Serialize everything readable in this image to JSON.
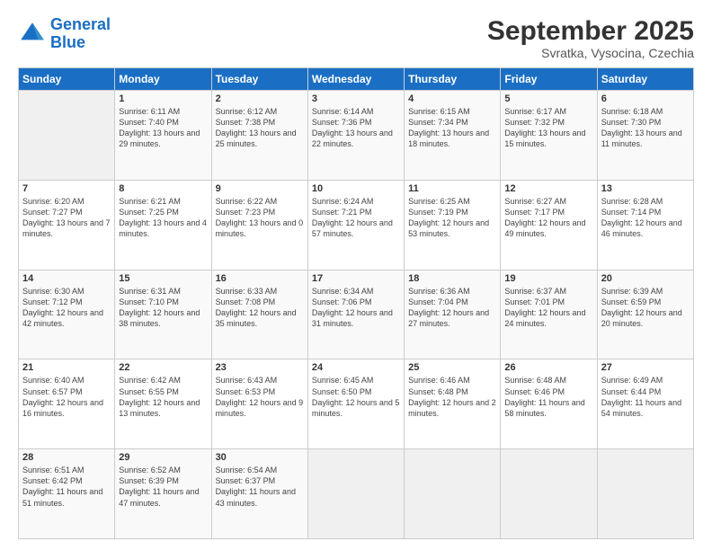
{
  "header": {
    "logo_general": "General",
    "logo_blue": "Blue",
    "month": "September 2025",
    "location": "Svratka, Vysocina, Czechia"
  },
  "weekdays": [
    "Sunday",
    "Monday",
    "Tuesday",
    "Wednesday",
    "Thursday",
    "Friday",
    "Saturday"
  ],
  "weeks": [
    [
      {
        "day": "",
        "sunrise": "",
        "sunset": "",
        "daylight": ""
      },
      {
        "day": "1",
        "sunrise": "Sunrise: 6:11 AM",
        "sunset": "Sunset: 7:40 PM",
        "daylight": "Daylight: 13 hours and 29 minutes."
      },
      {
        "day": "2",
        "sunrise": "Sunrise: 6:12 AM",
        "sunset": "Sunset: 7:38 PM",
        "daylight": "Daylight: 13 hours and 25 minutes."
      },
      {
        "day": "3",
        "sunrise": "Sunrise: 6:14 AM",
        "sunset": "Sunset: 7:36 PM",
        "daylight": "Daylight: 13 hours and 22 minutes."
      },
      {
        "day": "4",
        "sunrise": "Sunrise: 6:15 AM",
        "sunset": "Sunset: 7:34 PM",
        "daylight": "Daylight: 13 hours and 18 minutes."
      },
      {
        "day": "5",
        "sunrise": "Sunrise: 6:17 AM",
        "sunset": "Sunset: 7:32 PM",
        "daylight": "Daylight: 13 hours and 15 minutes."
      },
      {
        "day": "6",
        "sunrise": "Sunrise: 6:18 AM",
        "sunset": "Sunset: 7:30 PM",
        "daylight": "Daylight: 13 hours and 11 minutes."
      }
    ],
    [
      {
        "day": "7",
        "sunrise": "Sunrise: 6:20 AM",
        "sunset": "Sunset: 7:27 PM",
        "daylight": "Daylight: 13 hours and 7 minutes."
      },
      {
        "day": "8",
        "sunrise": "Sunrise: 6:21 AM",
        "sunset": "Sunset: 7:25 PM",
        "daylight": "Daylight: 13 hours and 4 minutes."
      },
      {
        "day": "9",
        "sunrise": "Sunrise: 6:22 AM",
        "sunset": "Sunset: 7:23 PM",
        "daylight": "Daylight: 13 hours and 0 minutes."
      },
      {
        "day": "10",
        "sunrise": "Sunrise: 6:24 AM",
        "sunset": "Sunset: 7:21 PM",
        "daylight": "Daylight: 12 hours and 57 minutes."
      },
      {
        "day": "11",
        "sunrise": "Sunrise: 6:25 AM",
        "sunset": "Sunset: 7:19 PM",
        "daylight": "Daylight: 12 hours and 53 minutes."
      },
      {
        "day": "12",
        "sunrise": "Sunrise: 6:27 AM",
        "sunset": "Sunset: 7:17 PM",
        "daylight": "Daylight: 12 hours and 49 minutes."
      },
      {
        "day": "13",
        "sunrise": "Sunrise: 6:28 AM",
        "sunset": "Sunset: 7:14 PM",
        "daylight": "Daylight: 12 hours and 46 minutes."
      }
    ],
    [
      {
        "day": "14",
        "sunrise": "Sunrise: 6:30 AM",
        "sunset": "Sunset: 7:12 PM",
        "daylight": "Daylight: 12 hours and 42 minutes."
      },
      {
        "day": "15",
        "sunrise": "Sunrise: 6:31 AM",
        "sunset": "Sunset: 7:10 PM",
        "daylight": "Daylight: 12 hours and 38 minutes."
      },
      {
        "day": "16",
        "sunrise": "Sunrise: 6:33 AM",
        "sunset": "Sunset: 7:08 PM",
        "daylight": "Daylight: 12 hours and 35 minutes."
      },
      {
        "day": "17",
        "sunrise": "Sunrise: 6:34 AM",
        "sunset": "Sunset: 7:06 PM",
        "daylight": "Daylight: 12 hours and 31 minutes."
      },
      {
        "day": "18",
        "sunrise": "Sunrise: 6:36 AM",
        "sunset": "Sunset: 7:04 PM",
        "daylight": "Daylight: 12 hours and 27 minutes."
      },
      {
        "day": "19",
        "sunrise": "Sunrise: 6:37 AM",
        "sunset": "Sunset: 7:01 PM",
        "daylight": "Daylight: 12 hours and 24 minutes."
      },
      {
        "day": "20",
        "sunrise": "Sunrise: 6:39 AM",
        "sunset": "Sunset: 6:59 PM",
        "daylight": "Daylight: 12 hours and 20 minutes."
      }
    ],
    [
      {
        "day": "21",
        "sunrise": "Sunrise: 6:40 AM",
        "sunset": "Sunset: 6:57 PM",
        "daylight": "Daylight: 12 hours and 16 minutes."
      },
      {
        "day": "22",
        "sunrise": "Sunrise: 6:42 AM",
        "sunset": "Sunset: 6:55 PM",
        "daylight": "Daylight: 12 hours and 13 minutes."
      },
      {
        "day": "23",
        "sunrise": "Sunrise: 6:43 AM",
        "sunset": "Sunset: 6:53 PM",
        "daylight": "Daylight: 12 hours and 9 minutes."
      },
      {
        "day": "24",
        "sunrise": "Sunrise: 6:45 AM",
        "sunset": "Sunset: 6:50 PM",
        "daylight": "Daylight: 12 hours and 5 minutes."
      },
      {
        "day": "25",
        "sunrise": "Sunrise: 6:46 AM",
        "sunset": "Sunset: 6:48 PM",
        "daylight": "Daylight: 12 hours and 2 minutes."
      },
      {
        "day": "26",
        "sunrise": "Sunrise: 6:48 AM",
        "sunset": "Sunset: 6:46 PM",
        "daylight": "Daylight: 11 hours and 58 minutes."
      },
      {
        "day": "27",
        "sunrise": "Sunrise: 6:49 AM",
        "sunset": "Sunset: 6:44 PM",
        "daylight": "Daylight: 11 hours and 54 minutes."
      }
    ],
    [
      {
        "day": "28",
        "sunrise": "Sunrise: 6:51 AM",
        "sunset": "Sunset: 6:42 PM",
        "daylight": "Daylight: 11 hours and 51 minutes."
      },
      {
        "day": "29",
        "sunrise": "Sunrise: 6:52 AM",
        "sunset": "Sunset: 6:39 PM",
        "daylight": "Daylight: 11 hours and 47 minutes."
      },
      {
        "day": "30",
        "sunrise": "Sunrise: 6:54 AM",
        "sunset": "Sunset: 6:37 PM",
        "daylight": "Daylight: 11 hours and 43 minutes."
      },
      {
        "day": "",
        "sunrise": "",
        "sunset": "",
        "daylight": ""
      },
      {
        "day": "",
        "sunrise": "",
        "sunset": "",
        "daylight": ""
      },
      {
        "day": "",
        "sunrise": "",
        "sunset": "",
        "daylight": ""
      },
      {
        "day": "",
        "sunrise": "",
        "sunset": "",
        "daylight": ""
      }
    ]
  ]
}
